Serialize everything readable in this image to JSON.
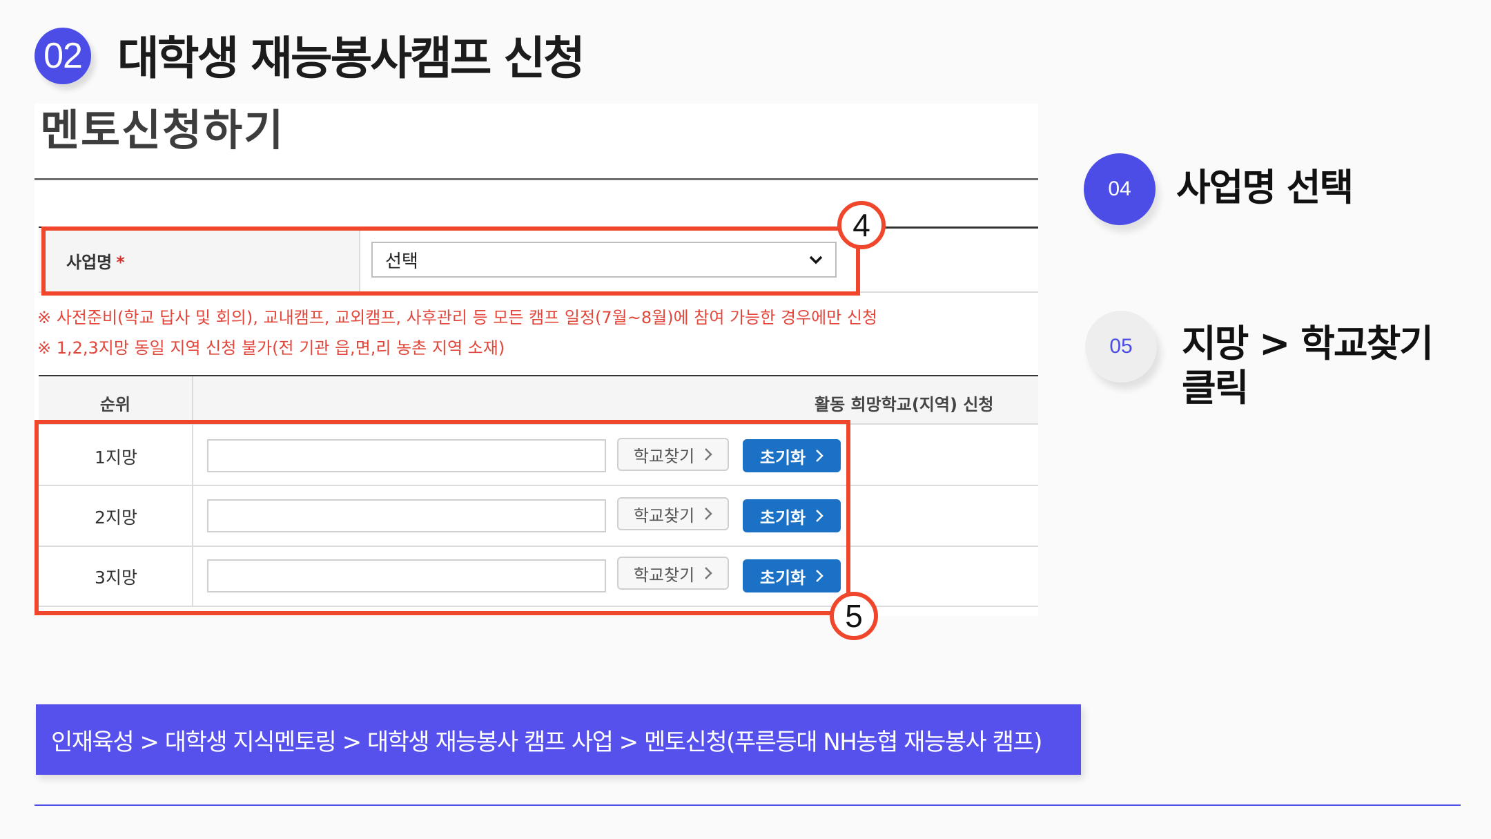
{
  "header": {
    "step_number": "02",
    "title": "대학생 재능봉사캠프 신청"
  },
  "form": {
    "title": "멘토신청하기",
    "business_name_label": "사업명",
    "required_mark": "*",
    "business_select_value": "선택",
    "notices": [
      "※ 사전준비(학교 답사 및 회의), 교내캠프, 교외캠프, 사후관리 등 모든 캠프 일정(7월~8월)에 참여 가능한 경우에만 신청",
      "※ 1,2,3지망 동일 지역 신청 불가(전 기관 읍,면,리 농촌 지역 소재)"
    ],
    "table": {
      "col_rank": "순위",
      "col_apply": "활동 희망학교(지역) 신청",
      "rows": [
        {
          "label": "1지망",
          "search": "학교찾기",
          "reset": "초기화"
        },
        {
          "label": "2지망",
          "search": "학교찾기",
          "reset": "초기화"
        },
        {
          "label": "3지망",
          "search": "학교찾기",
          "reset": "초기화"
        }
      ]
    }
  },
  "callouts": {
    "marker4": "4",
    "marker5": "5"
  },
  "steps": [
    {
      "number": "04",
      "text": "사업명 선택"
    },
    {
      "number": "05",
      "text_line1": "지망 > 학교찾기",
      "text_line2": "클릭"
    }
  ],
  "breadcrumb": "인재육성 > 대학생 지식멘토링 > 대학생 재능봉사 캠프 사업 > 멘토신청(푸른등대 NH농협 재능봉사 캠프)",
  "colors": {
    "accent": "#4b4de6",
    "highlight": "#f0472c",
    "button_blue": "#1a71c6",
    "notice_red": "#e2463b"
  },
  "icons": {
    "select_arrow": "chevron-down-icon",
    "button_arrow": "chevron-right-icon"
  }
}
